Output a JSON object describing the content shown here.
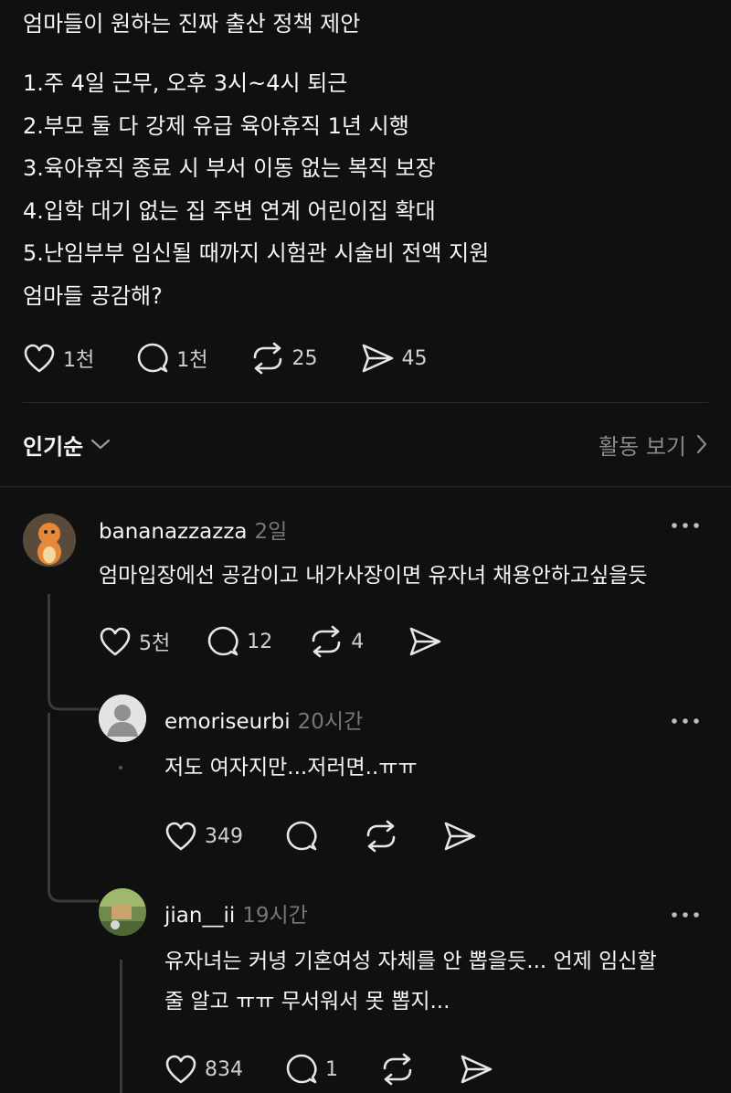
{
  "post": {
    "title": "엄마들이 원하는 진짜 출산 정책 제안",
    "lines": [
      "1.주 4일 근무, 오후 3시~4시 퇴근",
      "2.부모 둘 다 강제 유급 육아휴직 1년 시행",
      "3.육아휴직 종료 시 부서 이동 없는 복직 보장",
      "4.입학 대기 없는 집 주변 연계 어린이집 확대",
      "5.난임부부 임신될 때까지 시험관 시술비 전액 지원"
    ],
    "question": "엄마들 공감해?",
    "likes": "1천",
    "replies": "1천",
    "reposts": "25",
    "shares": "45"
  },
  "sort": {
    "label": "인기순",
    "activity_label": "활동 보기"
  },
  "comments": [
    {
      "username": "bananazzazza",
      "time": "2일",
      "text": "엄마입장에선 공감이고 내가사장이면 유자녀 채용안하고싶을듯",
      "likes": "5천",
      "replies": "12",
      "reposts": "4"
    },
    {
      "username": "emoriseurbi",
      "time": "20시간",
      "text": "저도 여자지만...저러면..ㅠㅠ",
      "likes": "349"
    },
    {
      "username": "jian__ii",
      "time": "19시간",
      "text_line1": "유자녀는 커녕 기혼여성 자체를 안 뽑을듯... 언제 임신할",
      "text_line2": "줄 알고 ㅠㅠ 무서워서 못 뽑지...",
      "likes": "834",
      "replies": "1"
    }
  ],
  "icons": {
    "like": "heart-icon",
    "reply": "comment-bubble-icon",
    "repost": "repost-icon",
    "share": "send-icon",
    "more": "more-dots-icon",
    "sort": "chevron-down-icon",
    "activity": "chevron-right-icon"
  },
  "colors": {
    "background": "#101010",
    "text": "#f3f5f7",
    "muted": "#777777"
  }
}
